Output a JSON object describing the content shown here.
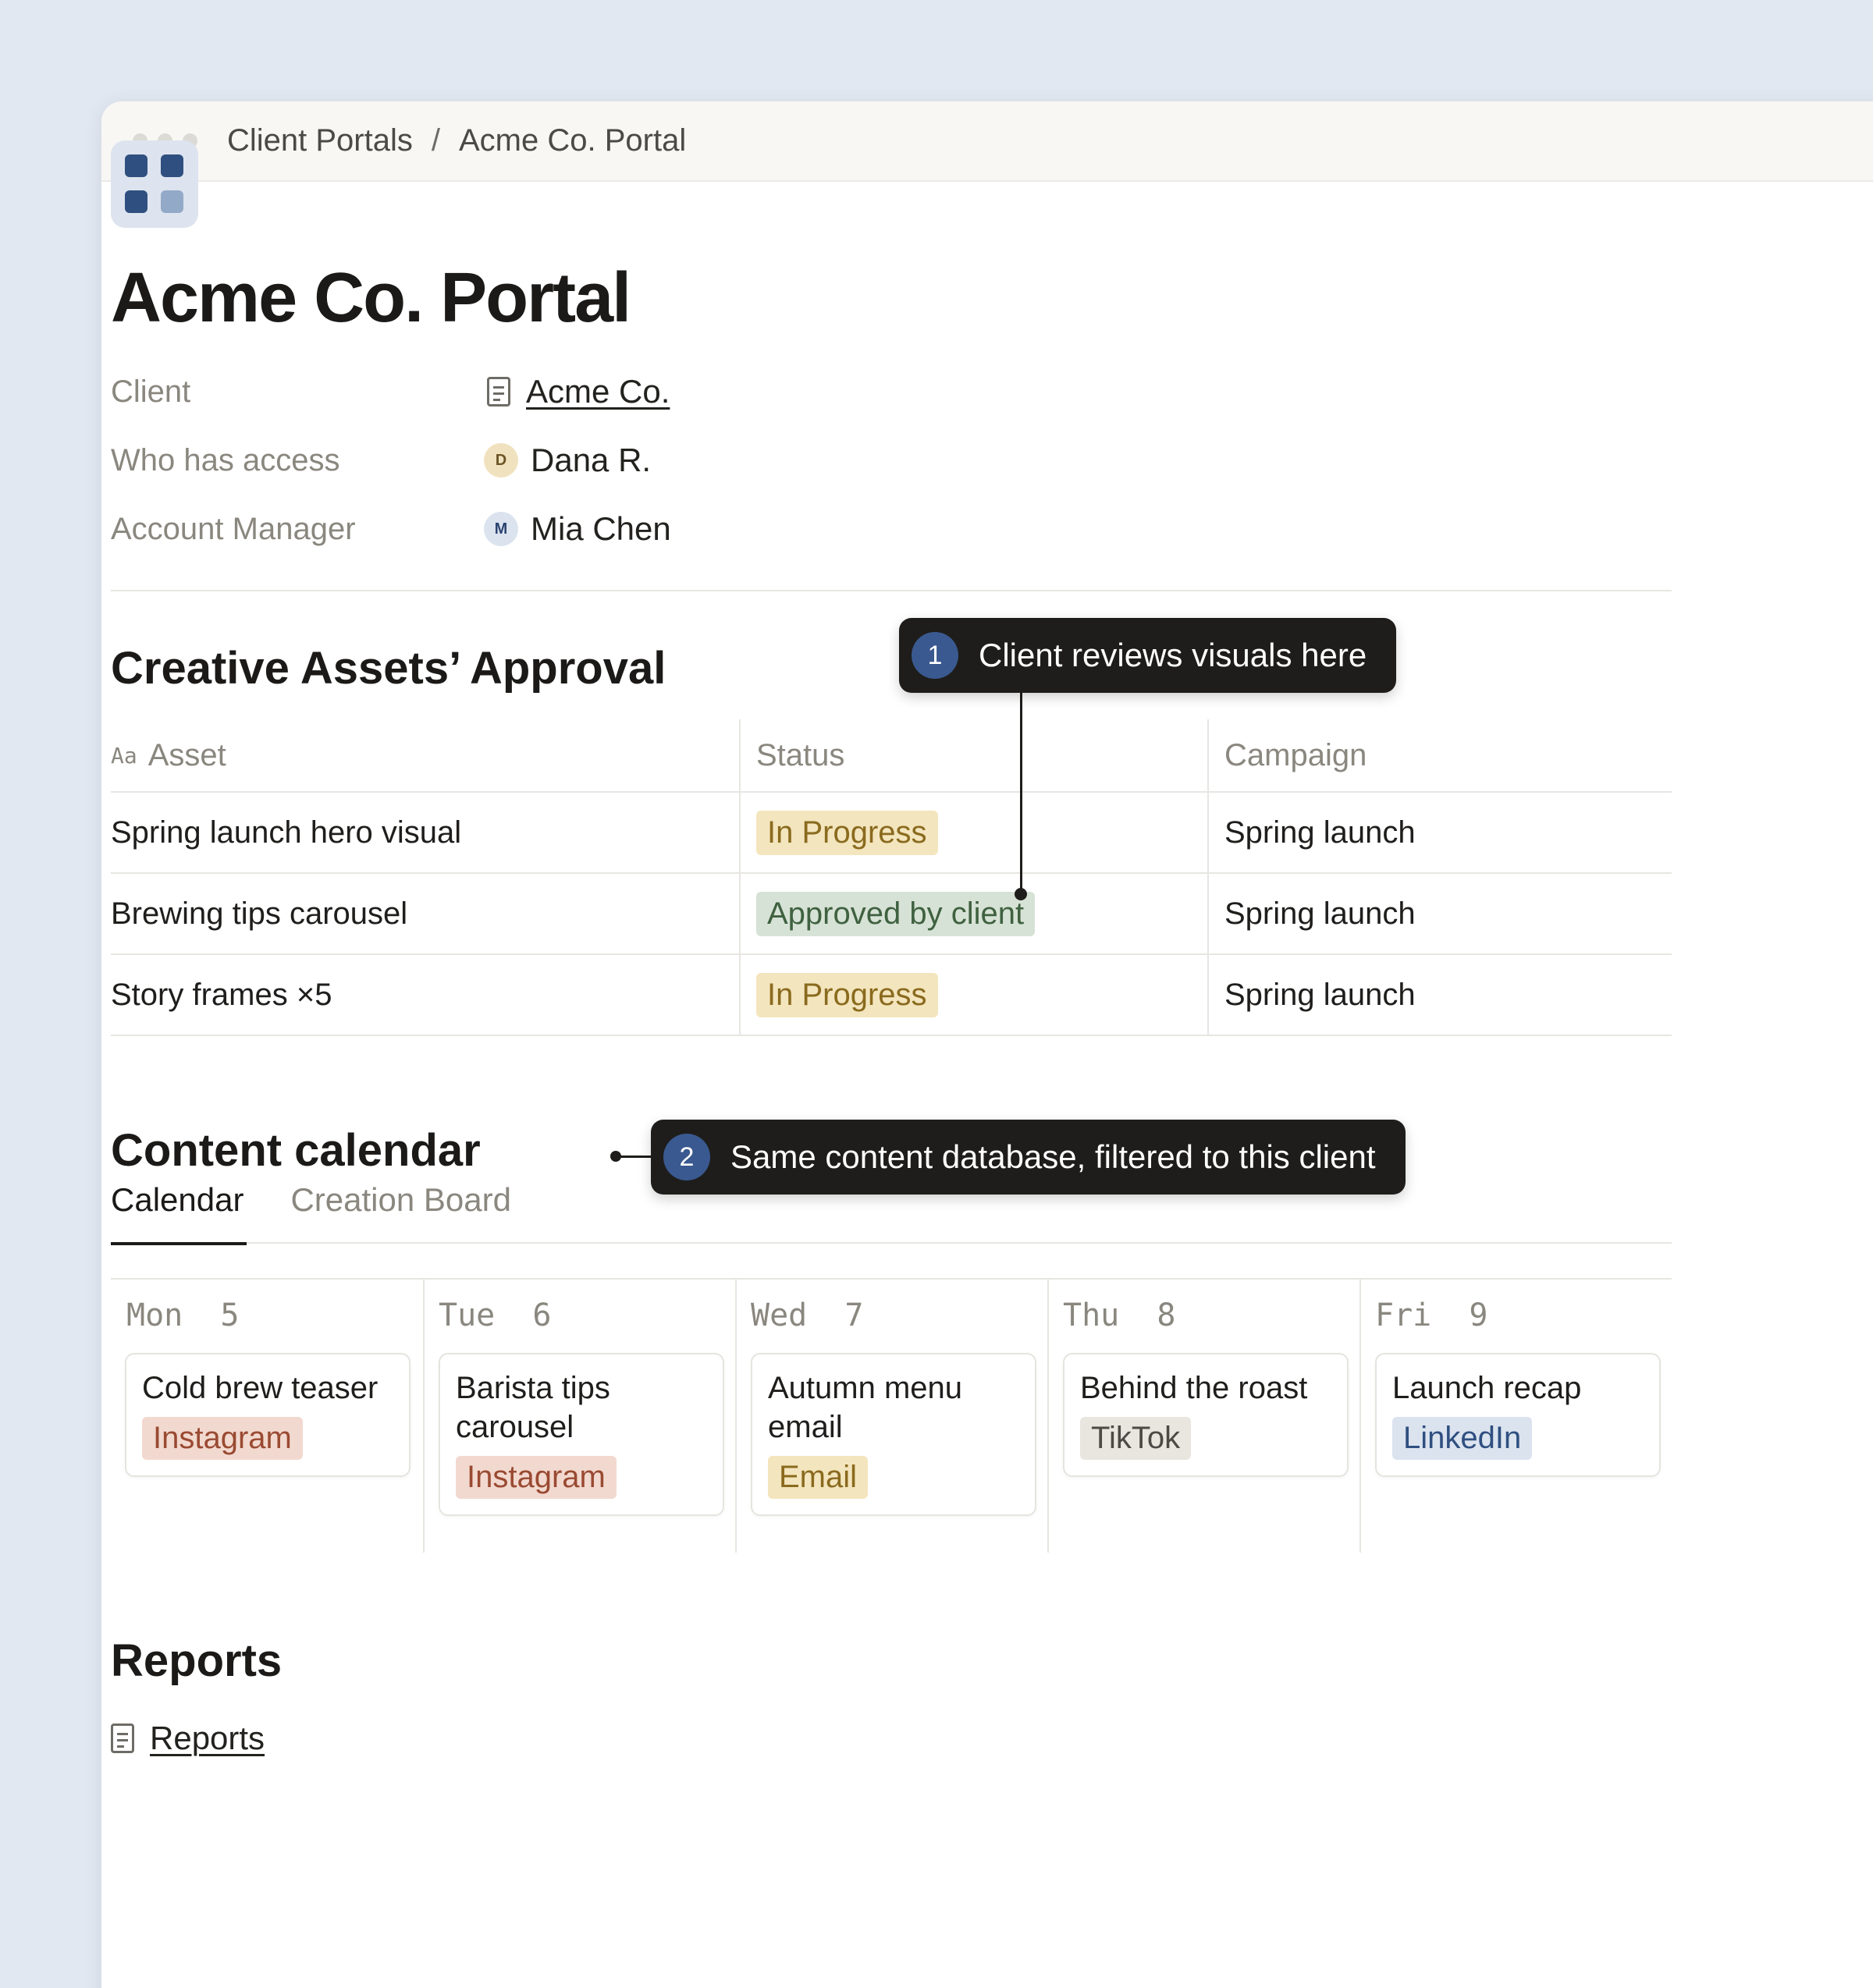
{
  "breadcrumb": {
    "parent": "Client Portals",
    "separator": "/",
    "current": "Acme Co. Portal"
  },
  "page": {
    "title": "Acme Co. Portal"
  },
  "properties": {
    "client_label": "Client",
    "client_value": "Acme Co.",
    "access_label": "Who has access",
    "access_avatar": "D",
    "access_value": "Dana R.",
    "manager_label": "Account Manager",
    "manager_avatar": "M",
    "manager_value": "Mia Chen"
  },
  "approval": {
    "title": "Creative Assets’ Approval",
    "columns": {
      "asset_prefix": "Aa",
      "asset": "Asset",
      "status": "Status",
      "campaign": "Campaign"
    },
    "rows": [
      {
        "asset": "Spring launch hero visual",
        "status": "In Progress",
        "campaign": "Spring launch"
      },
      {
        "asset": "Brewing tips carousel",
        "status": "Approved by client",
        "campaign": "Spring launch"
      },
      {
        "asset": "Story frames ×5",
        "status": "In Progress",
        "campaign": "Spring launch"
      }
    ]
  },
  "callouts": [
    {
      "number": "1",
      "text": "Client reviews visuals here"
    },
    {
      "number": "2",
      "text": "Same content database, filtered to this client"
    }
  ],
  "calendar": {
    "title": "Content calendar",
    "tabs": [
      "Calendar",
      "Creation Board"
    ],
    "days": [
      {
        "label": "Mon  5",
        "title": "Cold brew teaser",
        "tag": "Instagram",
        "tag_bg": "#f2d9cf",
        "tag_fg": "#9a4a32"
      },
      {
        "label": "Tue  6",
        "title": "Barista tips carousel",
        "tag": "Instagram",
        "tag_bg": "#f2d9cf",
        "tag_fg": "#9a4a32"
      },
      {
        "label": "Wed  7",
        "title": "Autumn menu email",
        "tag": "Email",
        "tag_bg": "#f3e5bd",
        "tag_fg": "#8a6a1e"
      },
      {
        "label": "Thu  8",
        "title": "Behind the roast",
        "tag": "TikTok",
        "tag_bg": "#e9e6e0",
        "tag_fg": "#4c4a45"
      },
      {
        "label": "Fri  9",
        "title": "Launch recap",
        "tag": "LinkedIn",
        "tag_bg": "#dbe3ef",
        "tag_fg": "#2f4f80"
      }
    ]
  },
  "reports": {
    "title": "Reports",
    "link": "Reports"
  },
  "colors": {
    "accent": "#3a5990",
    "callout_bg": "#1e1d1b",
    "page_bg": "#e2e8f1"
  }
}
